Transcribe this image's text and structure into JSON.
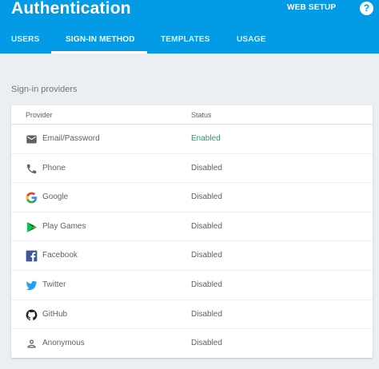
{
  "header": {
    "title": "Authentication",
    "web_setup": "WEB SETUP",
    "help_glyph": "?",
    "background": "#039be5"
  },
  "tabs": [
    {
      "label": "USERS",
      "active": false
    },
    {
      "label": "SIGN-IN METHOD",
      "active": true
    },
    {
      "label": "TEMPLATES",
      "active": false
    },
    {
      "label": "USAGE",
      "active": false
    }
  ],
  "section": {
    "label": "Sign-in providers"
  },
  "table": {
    "columns": [
      "Provider",
      "Status"
    ],
    "rows": [
      {
        "icon": "email-icon",
        "name": "Email/Password",
        "status": "Enabled"
      },
      {
        "icon": "phone-icon",
        "name": "Phone",
        "status": "Disabled"
      },
      {
        "icon": "google-icon",
        "name": "Google",
        "status": "Disabled"
      },
      {
        "icon": "play-games-icon",
        "name": "Play Games",
        "status": "Disabled"
      },
      {
        "icon": "facebook-icon",
        "name": "Facebook",
        "status": "Disabled"
      },
      {
        "icon": "twitter-icon",
        "name": "Twitter",
        "status": "Disabled"
      },
      {
        "icon": "github-icon",
        "name": "GitHub",
        "status": "Disabled"
      },
      {
        "icon": "anonymous-icon",
        "name": "Anonymous",
        "status": "Disabled"
      }
    ]
  },
  "colors": {
    "enabled": "#1e9e7a",
    "disabled": "#616161"
  }
}
